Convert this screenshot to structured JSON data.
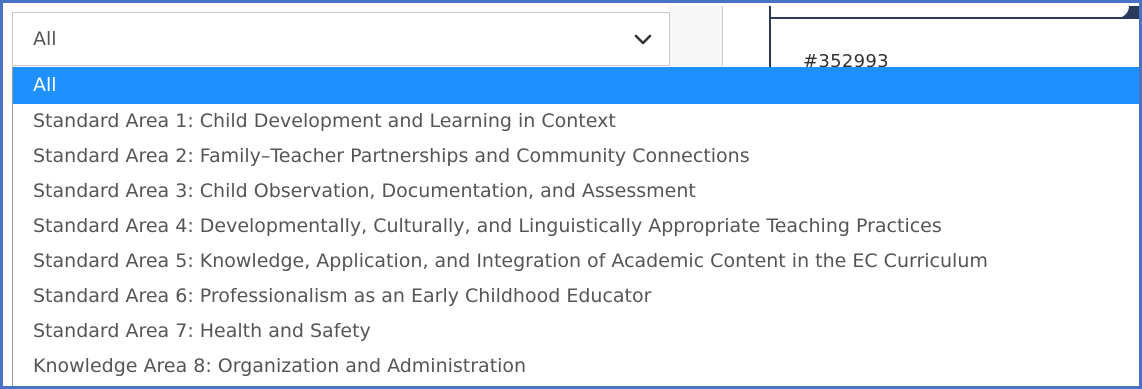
{
  "select": {
    "value": "All",
    "icon": "chevron-down-icon"
  },
  "record": {
    "id_text": "#352993"
  },
  "colors": {
    "selected_bg": "#1e90ff",
    "frame_border": "#4a72c4"
  },
  "options": [
    "All",
    "Standard Area 1: Child Development and Learning in Context",
    "Standard Area 2: Family–Teacher Partnerships and Community Connections",
    "Standard Area 3: Child Observation, Documentation, and Assessment",
    "Standard Area 4: Developmentally, Culturally, and Linguistically Appropriate Teaching Practices",
    "Standard Area 5: Knowledge, Application, and Integration of Academic Content in the EC Curriculum",
    "Standard Area 6: Professionalism as an Early Childhood Educator",
    "Standard Area 7: Health and Safety",
    "Knowledge Area 8: Organization and Administration"
  ],
  "selected_index": 0
}
